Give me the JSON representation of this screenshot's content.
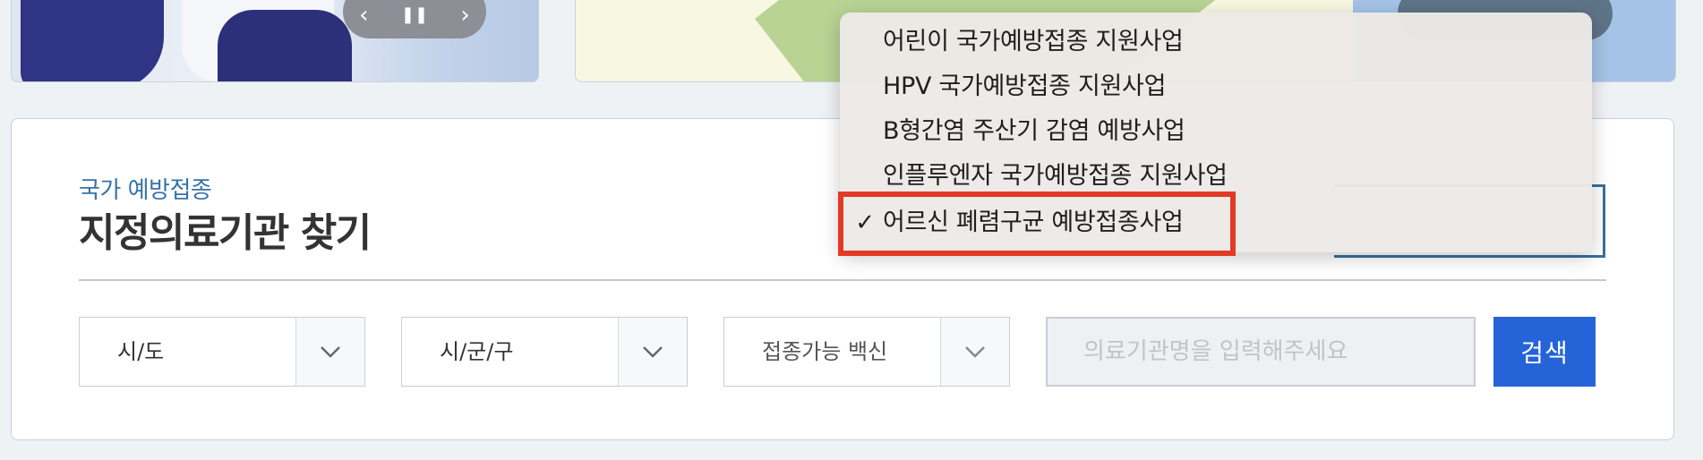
{
  "banner": {
    "slider_prev": "‹",
    "slider_pause": "❚❚",
    "slider_next": "›"
  },
  "section": {
    "subtitle": "국가 예방접종",
    "title": "지정의료기관 찾기"
  },
  "filters": {
    "sido": "시/도",
    "sigungu": "시/군/구",
    "vaccine": "접종가능 백신"
  },
  "search": {
    "placeholder": "의료기관명을 입력해주세요",
    "button_label": "검색"
  },
  "dropdown": {
    "items": [
      {
        "label": "어린이 국가예방접종 지원사업",
        "selected": false
      },
      {
        "label": "HPV 국가예방접종 지원사업",
        "selected": false
      },
      {
        "label": "B형간염 주산기 감염 예방사업",
        "selected": false
      },
      {
        "label": "인플루엔자 국가예방접종 지원사업",
        "selected": false
      },
      {
        "label": "어르신 폐렴구균 예방접종사업",
        "selected": true
      }
    ],
    "check_mark": "✓"
  },
  "colors": {
    "accent_blue": "#2563d8",
    "subtitle_blue": "#3773a8",
    "highlight_red": "#e23a25"
  }
}
